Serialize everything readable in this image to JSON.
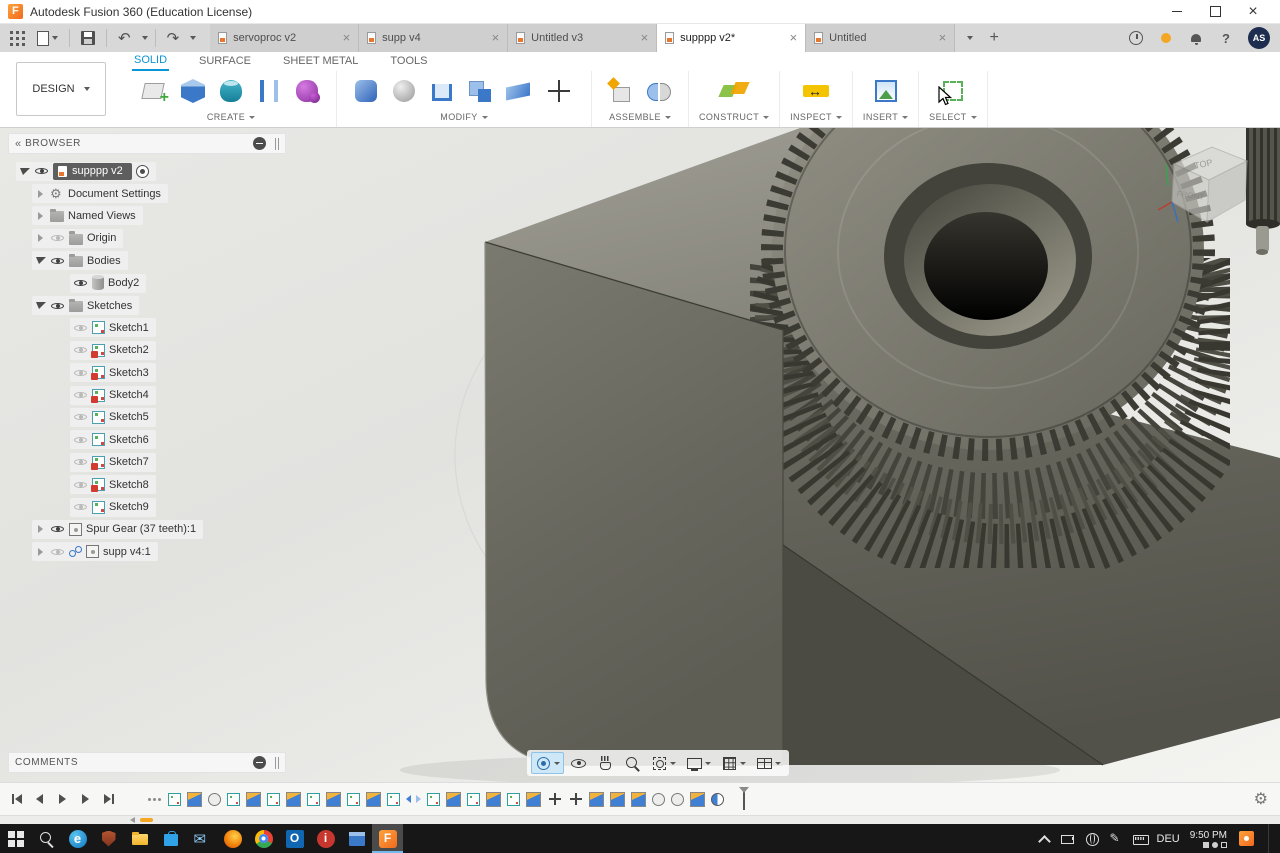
{
  "titlebar": {
    "title": "Autodesk Fusion 360 (Education License)"
  },
  "quickbar": {
    "icons": [
      "data-panel",
      "file-menu",
      "save",
      "undo",
      "redo"
    ]
  },
  "doc_tabs": {
    "tabs": [
      {
        "label": "servoproc v2",
        "active": false
      },
      {
        "label": "supp v4",
        "active": false
      },
      {
        "label": "Untitled v3",
        "active": false
      },
      {
        "label": "supppp v2*",
        "active": true
      },
      {
        "label": "Untitled",
        "active": false
      }
    ],
    "right_icons": [
      "job",
      "status",
      "bell",
      "help"
    ],
    "avatar": "AS"
  },
  "ribbon": {
    "workspace": "DESIGN",
    "tabs": [
      {
        "label": "SOLID",
        "active": true
      },
      {
        "label": "SURFACE",
        "active": false
      },
      {
        "label": "SHEET METAL",
        "active": false
      },
      {
        "label": "TOOLS",
        "active": false
      }
    ],
    "groups": [
      {
        "label": "CREATE",
        "icons": [
          "create-sketch",
          "extrude",
          "revolve",
          "loft",
          "form"
        ]
      },
      {
        "label": "MODIFY",
        "icons": [
          "press-pull",
          "fillet",
          "shell",
          "combine",
          "offset-face",
          "move"
        ]
      },
      {
        "label": "ASSEMBLE",
        "icons": [
          "new-component",
          "joint"
        ]
      },
      {
        "label": "CONSTRUCT",
        "icons": [
          "construct-plane"
        ]
      },
      {
        "label": "INSPECT",
        "icons": [
          "measure"
        ]
      },
      {
        "label": "INSERT",
        "icons": [
          "insert-canvas"
        ]
      },
      {
        "label": "SELECT",
        "icons": [
          "select-window"
        ]
      }
    ]
  },
  "browser": {
    "header": "BROWSER",
    "root": {
      "label": "supppp v2"
    },
    "items": [
      {
        "depth": 1,
        "expander": "collapsed",
        "eye": "none",
        "icon": "gear",
        "label": "Document Settings"
      },
      {
        "depth": 1,
        "expander": "collapsed",
        "eye": "none",
        "icon": "folder",
        "label": "Named Views"
      },
      {
        "depth": 1,
        "expander": "collapsed",
        "eye": "off",
        "icon": "folder",
        "label": "Origin"
      },
      {
        "depth": 1,
        "expander": "expanded",
        "eye": "on",
        "icon": "folder",
        "label": "Bodies"
      },
      {
        "depth": 2,
        "expander": "none",
        "eye": "on",
        "icon": "body",
        "label": "Body2"
      },
      {
        "depth": 1,
        "expander": "expanded",
        "eye": "on",
        "icon": "folder",
        "label": "Sketches"
      },
      {
        "depth": 2,
        "expander": "none",
        "eye": "off",
        "icon": "sketch",
        "label": "Sketch1"
      },
      {
        "depth": 2,
        "expander": "none",
        "eye": "off",
        "icon": "sketch-locked",
        "label": "Sketch2"
      },
      {
        "depth": 2,
        "expander": "none",
        "eye": "off",
        "icon": "sketch-locked",
        "label": "Sketch3"
      },
      {
        "depth": 2,
        "expander": "none",
        "eye": "off",
        "icon": "sketch-locked",
        "label": "Sketch4"
      },
      {
        "depth": 2,
        "expander": "none",
        "eye": "off",
        "icon": "sketch",
        "label": "Sketch5"
      },
      {
        "depth": 2,
        "expander": "none",
        "eye": "off",
        "icon": "sketch",
        "label": "Sketch6"
      },
      {
        "depth": 2,
        "expander": "none",
        "eye": "off",
        "icon": "sketch-locked",
        "label": "Sketch7"
      },
      {
        "depth": 2,
        "expander": "none",
        "eye": "off",
        "icon": "sketch-locked",
        "label": "Sketch8"
      },
      {
        "depth": 2,
        "expander": "none",
        "eye": "off",
        "icon": "sketch",
        "label": "Sketch9"
      },
      {
        "depth": 1,
        "expander": "collapsed",
        "eye": "on",
        "icon": "component",
        "label": "Spur Gear (37 teeth):1"
      },
      {
        "depth": 1,
        "expander": "collapsed",
        "eye": "off",
        "icon": "component-linked",
        "label": "supp v4:1"
      }
    ]
  },
  "comments": {
    "header": "COMMENTS"
  },
  "viewcube": {
    "faces": {
      "top": "TOP",
      "front": "FRONT"
    }
  },
  "navbar": {
    "buttons": [
      {
        "icon": "orbit",
        "selected": true,
        "dropdown": true
      },
      {
        "icon": "look-at",
        "selected": false,
        "dropdown": false
      },
      {
        "icon": "pan",
        "selected": false,
        "dropdown": false
      },
      {
        "icon": "zoom",
        "selected": false,
        "dropdown": false
      },
      {
        "icon": "fit",
        "selected": false,
        "dropdown": true
      },
      {
        "icon": "display-settings",
        "selected": false,
        "dropdown": true
      },
      {
        "icon": "grid-display",
        "selected": false,
        "dropdown": true
      },
      {
        "icon": "viewports",
        "selected": false,
        "dropdown": true
      }
    ]
  },
  "timeline": {
    "controls": [
      "skip-start",
      "step-back",
      "play",
      "step-forward",
      "skip-end"
    ],
    "features": [
      "group-dots",
      "sketch",
      "extrude",
      "hole",
      "sketch",
      "extrude",
      "sketch",
      "extrude",
      "sketch",
      "extrude",
      "sketch",
      "extrude",
      "sketch",
      "mirror",
      "sketch",
      "extrude",
      "sketch",
      "extrude",
      "sketch",
      "extrude",
      "move",
      "move",
      "extrude",
      "extrude",
      "extrude",
      "hole",
      "hole",
      "extrude",
      "section"
    ],
    "settings_icon": "gear"
  },
  "taskbar": {
    "apps": [
      "start",
      "search",
      "edge",
      "defender",
      "explorer",
      "store",
      "mail",
      "firefox",
      "chrome",
      "outlook",
      "info",
      "app-window",
      "fusion"
    ],
    "active_app": "fusion",
    "tray_icons": [
      "chevron-up",
      "battery",
      "globe",
      "pen",
      "keyboard"
    ],
    "language": "DEU",
    "time": "9:50 PM",
    "indicator_icons": [
      "lock",
      "display",
      "pen"
    ]
  },
  "colors": {
    "accent_blue": "#0a96d6",
    "fusion_orange": "#f06a1e",
    "highlight_orange": "#f5a623",
    "selection_blue": "#cfe8f8"
  }
}
